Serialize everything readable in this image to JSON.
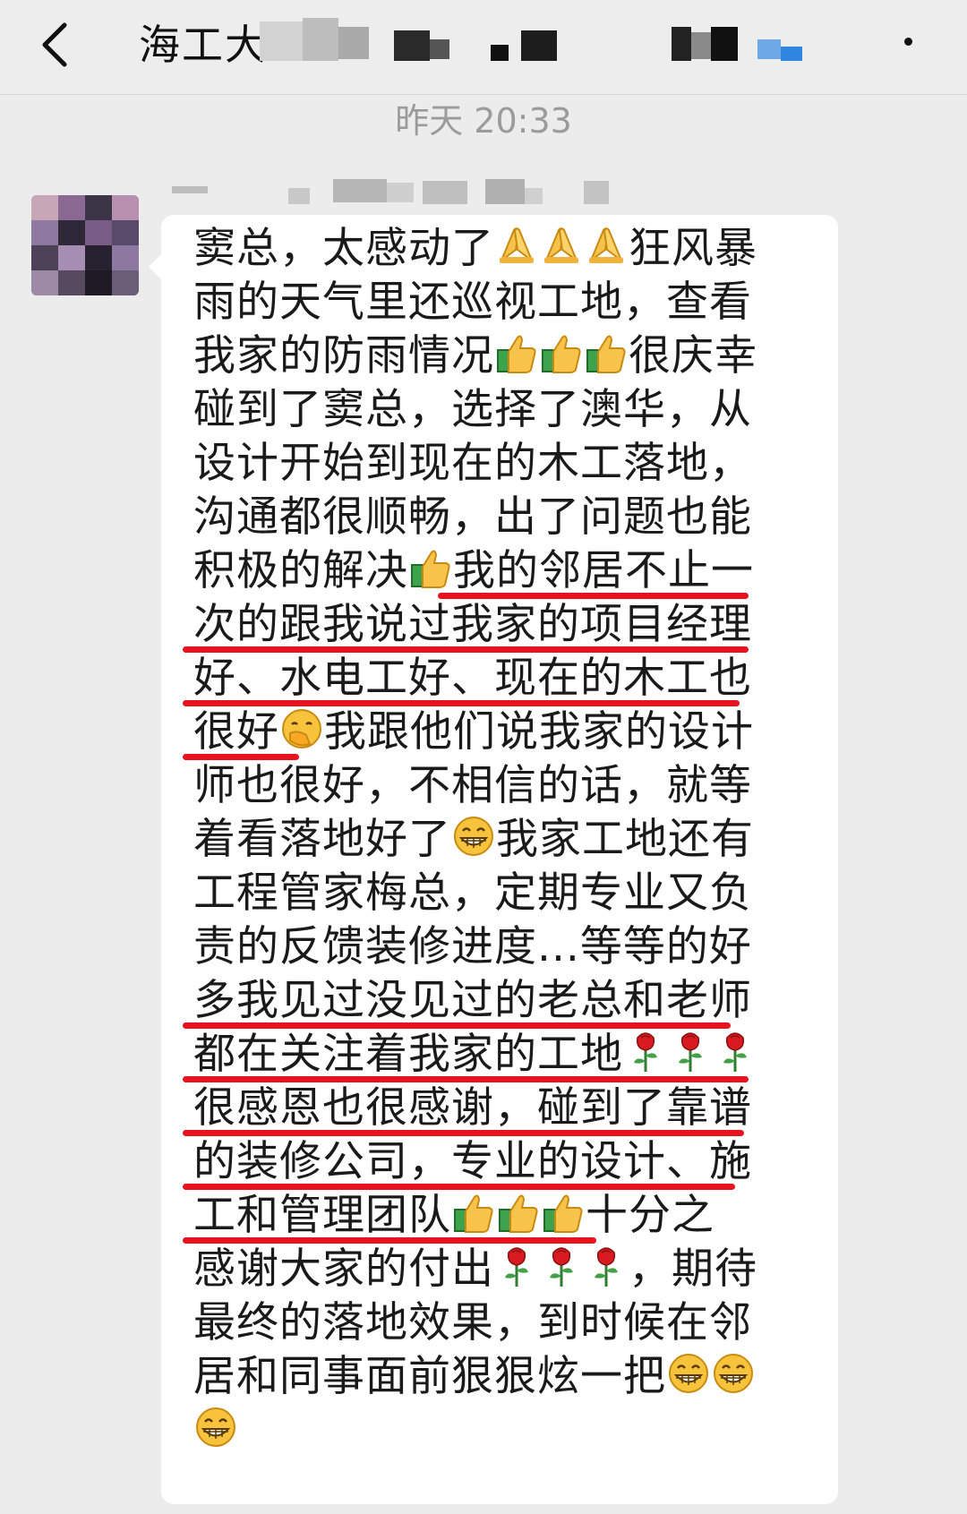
{
  "header": {
    "title": "海工大",
    "back_icon": "chevron-left-icon",
    "more_icon": "more-dots-icon"
  },
  "chat": {
    "timestamp": "昨天 20:33",
    "message_lines": [
      [
        "窦总，太感动了",
        "🙏🙏🙏",
        "狂风暴"
      ],
      [
        "雨的天气里还巡视工地，查看"
      ],
      [
        "我家的防雨情况",
        "👍👍👍",
        "很庆幸"
      ],
      [
        "碰到了窦总，选择了澳华，从"
      ],
      [
        "设计开始到现在的木工落地，"
      ],
      [
        "沟通都很顺畅，出了问题也能"
      ],
      [
        "积极的解决",
        "👍",
        "我的邻居不止一"
      ],
      [
        "次的跟我说过我家的项目经理"
      ],
      [
        "好、水电工好、现在的木工也"
      ],
      [
        "很好",
        "🤭",
        "我跟他们说我家的设计"
      ],
      [
        "师也很好，不相信的话，就等"
      ],
      [
        "着看落地好了",
        "😁",
        "我家工地还有"
      ],
      [
        "工程管家梅总，定期专业又负"
      ],
      [
        "责的反馈装修进度...等等的好"
      ],
      [
        "多我见过没见过的老总和老师"
      ],
      [
        "都在关注着我家的工地",
        "🌹🌹🌹",
        ""
      ],
      [
        "很感恩也很感谢，碰到了靠谱"
      ],
      [
        "的装修公司，专业的设计、施"
      ],
      [
        "工和管理团队",
        "👍👍👍",
        "十分之"
      ],
      [
        "感谢大家的付出",
        "🌹🌹🌹",
        "，期待"
      ],
      [
        "最终的落地效果，到时候在邻"
      ],
      [
        "居和同事面前狠狠炫一把",
        "😁😁",
        ""
      ],
      [
        "",
        "😁",
        ""
      ]
    ]
  },
  "colors": {
    "background": "#ececec",
    "bubble": "#ffffff",
    "underline": "#e8131f",
    "timestamp": "#9b9b9b"
  }
}
